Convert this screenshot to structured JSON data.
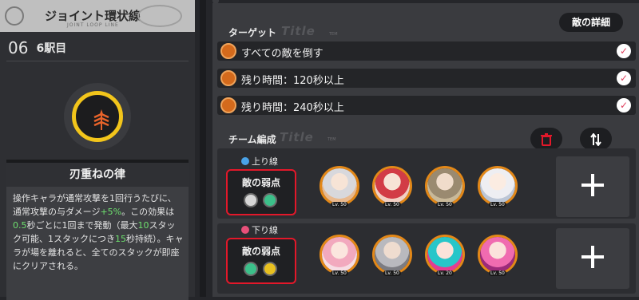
{
  "stage_panel": {
    "title": "ジョイント環状線",
    "subtitle": "JOINT LOOP LINE",
    "stage_number": "06",
    "stage_label": "6駅目"
  },
  "effect": {
    "name": "刃重ねの律",
    "description_parts": [
      "操作キャラが通常攻撃を1回行うたびに、通常攻撃の与ダメージ",
      "+5%",
      "。この効果は",
      "0.5",
      "秒ごとに1回まで発動（最大",
      "10",
      "スタック可能、1スタックにつき",
      "15",
      "秒持続）。キャラが場を離れると、全てのスタックが即座にクリアされる。"
    ]
  },
  "detail_button": "敵の詳細",
  "targets_section": {
    "title": "ターゲット",
    "deco": "Title",
    "tm": "TEM",
    "items": [
      {
        "label": "すべての敵を倒す",
        "checked": true
      },
      {
        "label": "残り時間：120秒以上",
        "checked": true
      },
      {
        "label": "残り時間：240秒以上",
        "checked": true
      }
    ]
  },
  "team_section": {
    "title": "チーム編成",
    "deco": "Title",
    "tm": "TEM",
    "delete_icon": "trash-icon",
    "swap_icon": "swap-vertical-icon"
  },
  "upper_line": {
    "label": "上り線",
    "weakness_label": "敵の弱点",
    "weakness_icons": [
      "physical-icon",
      "wind-icon"
    ],
    "characters": [
      {
        "level": "Lv. 50",
        "hair": "#d8d8dc",
        "bg": "#e9b98e"
      },
      {
        "level": "Lv. 50",
        "hair": "#d23c46",
        "bg": "#f2d0c4"
      },
      {
        "level": "Lv. 50",
        "hair": "#9a8a70",
        "bg": "#c9b999"
      },
      {
        "level": "Lv. 50",
        "hair": "#eeeef2",
        "bg": "#bcc6d6"
      }
    ]
  },
  "lower_line": {
    "label": "下り線",
    "weakness_label": "敵の弱点",
    "weakness_icons": [
      "wind-icon",
      "lightning-icon"
    ],
    "characters": [
      {
        "level": "Lv. 50",
        "hair": "#f2a9be",
        "bg": "#f6dde4"
      },
      {
        "level": "Lv. 50",
        "hair": "#b9b9be",
        "bg": "#7c7c82"
      },
      {
        "level": "Lv. 20",
        "hair": "#27c6c9",
        "bg": "#e43c92"
      },
      {
        "level": "Lv. 50",
        "hair": "#f06bb0",
        "bg": "#9c2a7a"
      }
    ]
  },
  "colors": {
    "accent": "#e38818",
    "check": "#e0405e",
    "highlight_border": "#e3182a",
    "emblem": "#f2c51b",
    "green_text": "#6ee06e"
  }
}
